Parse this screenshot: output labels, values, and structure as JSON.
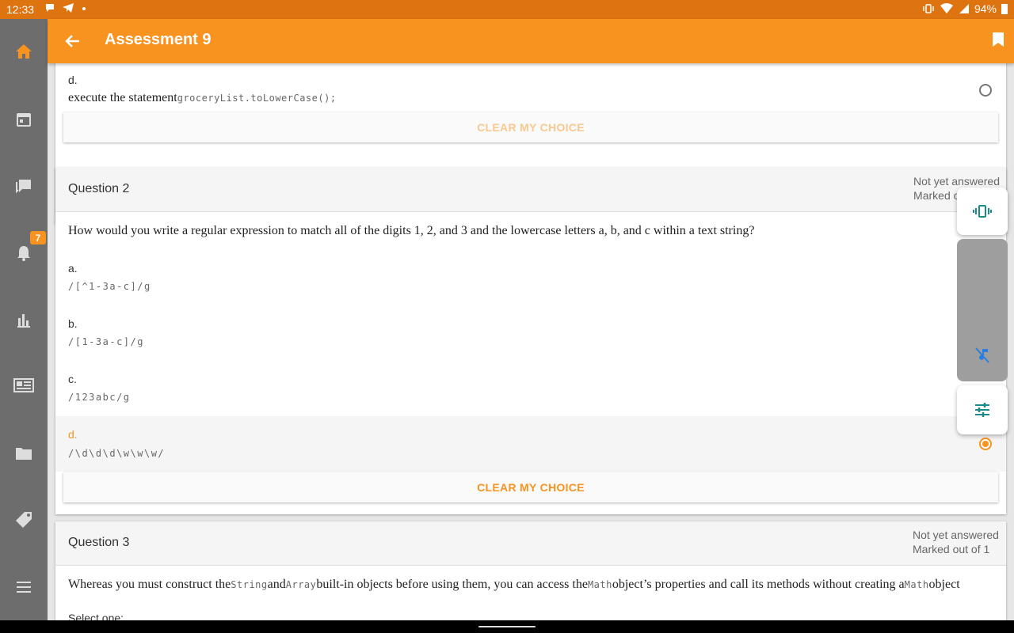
{
  "status_bar": {
    "time": "12:33",
    "battery": "94%"
  },
  "app_bar": {
    "title": "Assessment 9"
  },
  "sidebar": {
    "notifications_badge": "7"
  },
  "question1_tail": {
    "option_letter": "d.",
    "option_text": "execute the statement",
    "option_code": "groceryList.toLowerCase();",
    "clear_label": "CLEAR MY CHOICE"
  },
  "question2": {
    "title": "Question 2",
    "status": "Not yet answered",
    "marked_partial": "Marked o",
    "text": "How would you write a regular expression to match all of the digits 1, 2, and 3 and the lowercase letters a, b, and c within a text string?",
    "options": [
      {
        "letter": "a.",
        "code": "/[^1-3a-c]/g"
      },
      {
        "letter": "b.",
        "code": "/[1-3a-c]/g"
      },
      {
        "letter": "c.",
        "code": "/123abc/g"
      },
      {
        "letter": "d.",
        "code": "/\\d\\d\\d\\w\\w\\w/"
      }
    ],
    "selected": "d.",
    "clear_label": "CLEAR MY CHOICE"
  },
  "question3": {
    "title": "Question 3",
    "status": "Not yet answered",
    "marked": "Marked out of 1",
    "text_part1": "Whereas you must construct the",
    "code1": "String",
    "text_part2": "and",
    "code2": "Array",
    "text_part3": "built-in objects before using them, you can access the",
    "code3": "Math",
    "text_part4": "object’s properties and call its methods without creating a",
    "code4": "Math",
    "text_part5": "object",
    "select_one": "Select one:"
  },
  "colors": {
    "accent": "#f7931e",
    "status_bar": "#de7410",
    "sidebar": "#6d6d6d"
  }
}
